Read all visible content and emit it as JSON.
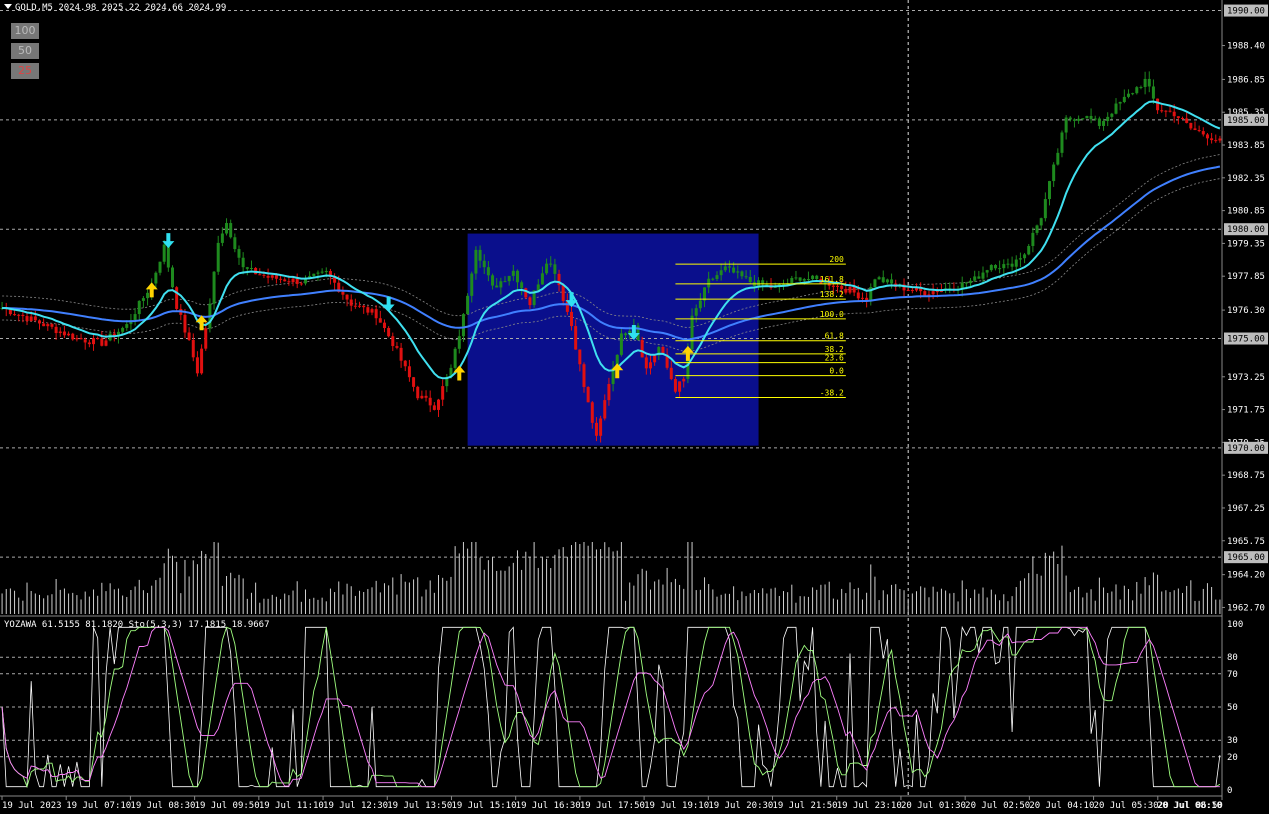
{
  "header": {
    "symbol_info": "GOLD,M5  2024.98 2025.22 2024.66 2024.99"
  },
  "zoom_buttons": [
    {
      "label": "100",
      "color": "#bbbbbb"
    },
    {
      "label": "50",
      "color": "#bbbbbb"
    },
    {
      "label": "25",
      "color": "#dd4444"
    }
  ],
  "oscillator": {
    "label": "YOZAWA 61.5155 81.1820 Sto(5,3,3) 17.1815 18.9667"
  },
  "colors": {
    "up": "#1e8a1e",
    "down": "#e01010",
    "fast_ma": "#40e0f0",
    "slow_ma": "#4080ff",
    "box": "#0a0f8c",
    "fib": "#ffff00",
    "osc_main": "#ffffff",
    "osc_k": "#a0ff80",
    "osc_d": "#ff80ff"
  },
  "chart_data": [
    {
      "type": "candlestick",
      "title": "",
      "yticks": [
        "1990.00",
        "1988.40",
        "1986.85",
        "1985.35",
        "1985.00",
        "1983.85",
        "1982.35",
        "1980.85",
        "1980.00",
        "1979.35",
        "1977.85",
        "1976.30",
        "1975.00",
        "1973.25",
        "1971.75",
        "1970.25",
        "1970.00",
        "1968.75",
        "1967.25",
        "1965.75",
        "1965.00",
        "1964.20",
        "1962.70"
      ],
      "highlighted_levels": [
        "1990.00",
        "1985.00",
        "1980.00",
        "1975.00",
        "1970.00",
        "1965.00"
      ],
      "ylim": [
        1962.4,
        1990.3
      ],
      "xticks": [
        "19 Jul 2023",
        "19 Jul 07:10",
        "19 Jul 08:30",
        "19 Jul 09:50",
        "19 Jul 11:10",
        "19 Jul 12:30",
        "19 Jul 13:50",
        "19 Jul 15:10",
        "19 Jul 16:30",
        "19 Jul 17:50",
        "19 Jul 19:10",
        "19 Jul 20:30",
        "19 Jul 21:50",
        "19 Jul 23:10",
        "20 Jul 01:30",
        "20 Jul 02:50",
        "20 Jul 04:10",
        "20 Jul 05:30",
        "20 Jul 06:50",
        "20 Jul 08:10"
      ],
      "close_anchors": [
        [
          0,
          1976.4
        ],
        [
          8,
          1975.8
        ],
        [
          18,
          1975.0
        ],
        [
          24,
          1974.8
        ],
        [
          30,
          1975.6
        ],
        [
          36,
          1977.5
        ],
        [
          39,
          1979.2
        ],
        [
          42,
          1976.5
        ],
        [
          45,
          1974.8
        ],
        [
          47,
          1973.5
        ],
        [
          50,
          1976.5
        ],
        [
          52,
          1979.5
        ],
        [
          54,
          1980.3
        ],
        [
          58,
          1978.2
        ],
        [
          64,
          1977.8
        ],
        [
          72,
          1977.6
        ],
        [
          78,
          1978.0
        ],
        [
          84,
          1976.6
        ],
        [
          90,
          1976.1
        ],
        [
          94,
          1974.8
        ],
        [
          100,
          1972.4
        ],
        [
          104,
          1971.9
        ],
        [
          108,
          1973.6
        ],
        [
          111,
          1976.0
        ],
        [
          114,
          1979.2
        ],
        [
          118,
          1977.3
        ],
        [
          123,
          1978.1
        ],
        [
          127,
          1976.6
        ],
        [
          131,
          1978.6
        ],
        [
          133,
          1978.1
        ],
        [
          137,
          1975.6
        ],
        [
          140,
          1972.8
        ],
        [
          143,
          1970.4
        ],
        [
          146,
          1973.0
        ],
        [
          149,
          1975.1
        ],
        [
          152,
          1975.7
        ],
        [
          155,
          1973.6
        ],
        [
          158,
          1974.6
        ],
        [
          162,
          1972.7
        ],
        [
          164,
          1973.1
        ],
        [
          166,
          1975.9
        ],
        [
          170,
          1977.6
        ],
        [
          174,
          1978.2
        ],
        [
          180,
          1977.6
        ],
        [
          186,
          1977.3
        ],
        [
          192,
          1977.8
        ],
        [
          198,
          1977.6
        ],
        [
          204,
          1977.2
        ],
        [
          208,
          1976.8
        ],
        [
          210,
          1977.8
        ],
        [
          215,
          1977.4
        ],
        [
          222,
          1977.1
        ],
        [
          230,
          1977.4
        ],
        [
          234,
          1977.7
        ],
        [
          238,
          1978.4
        ],
        [
          242,
          1978.3
        ],
        [
          246,
          1978.9
        ],
        [
          250,
          1980.6
        ],
        [
          253,
          1982.8
        ],
        [
          256,
          1985.0
        ],
        [
          260,
          1985.2
        ],
        [
          264,
          1984.8
        ],
        [
          268,
          1985.6
        ],
        [
          272,
          1986.3
        ],
        [
          275,
          1986.8
        ],
        [
          278,
          1985.5
        ],
        [
          282,
          1985.3
        ],
        [
          286,
          1984.6
        ],
        [
          290,
          1984.3
        ],
        [
          293,
          1984.0
        ]
      ],
      "n_bars": 294,
      "box": {
        "x_start": 112,
        "x_end": 182,
        "y_high": 1979.8,
        "y_low": 1970.1
      },
      "fib_levels": [
        {
          "label": "200",
          "value": 1978.4
        },
        {
          "label": "161.8",
          "value": 1977.5
        },
        {
          "label": "138.2",
          "value": 1976.8
        },
        {
          "label": "100.0",
          "value": 1975.9
        },
        {
          "label": "61.8",
          "value": 1974.9
        },
        {
          "label": "38.2",
          "value": 1974.3
        },
        {
          "label": "23.6",
          "value": 1973.9
        },
        {
          "label": "0.0",
          "value": 1973.3
        },
        {
          "label": "-38.2",
          "value": 1972.3
        }
      ],
      "fib_x_range": [
        162,
        203
      ],
      "arrows": [
        {
          "bar": 40,
          "dir": "down",
          "value": 1979.5
        },
        {
          "bar": 36,
          "dir": "up",
          "value": 1977.2
        },
        {
          "bar": 48,
          "dir": "up",
          "value": 1975.7
        },
        {
          "bar": 93,
          "dir": "down",
          "value": 1976.6
        },
        {
          "bar": 110,
          "dir": "up",
          "value": 1973.4
        },
        {
          "bar": 137,
          "dir": "down",
          "value": 1976.8
        },
        {
          "bar": 148,
          "dir": "up",
          "value": 1973.5
        },
        {
          "bar": 152,
          "dir": "down",
          "value": 1975.3
        },
        {
          "bar": 165,
          "dir": "up",
          "value": 1974.3
        }
      ],
      "crosshair_bar": 218
    },
    {
      "type": "line",
      "title": "",
      "yticks": [
        "100",
        "80",
        "70",
        "50",
        "30",
        "20",
        "0"
      ],
      "ylim": [
        0,
        100
      ],
      "dashed_levels": [
        80,
        70,
        50,
        30,
        20
      ]
    }
  ]
}
